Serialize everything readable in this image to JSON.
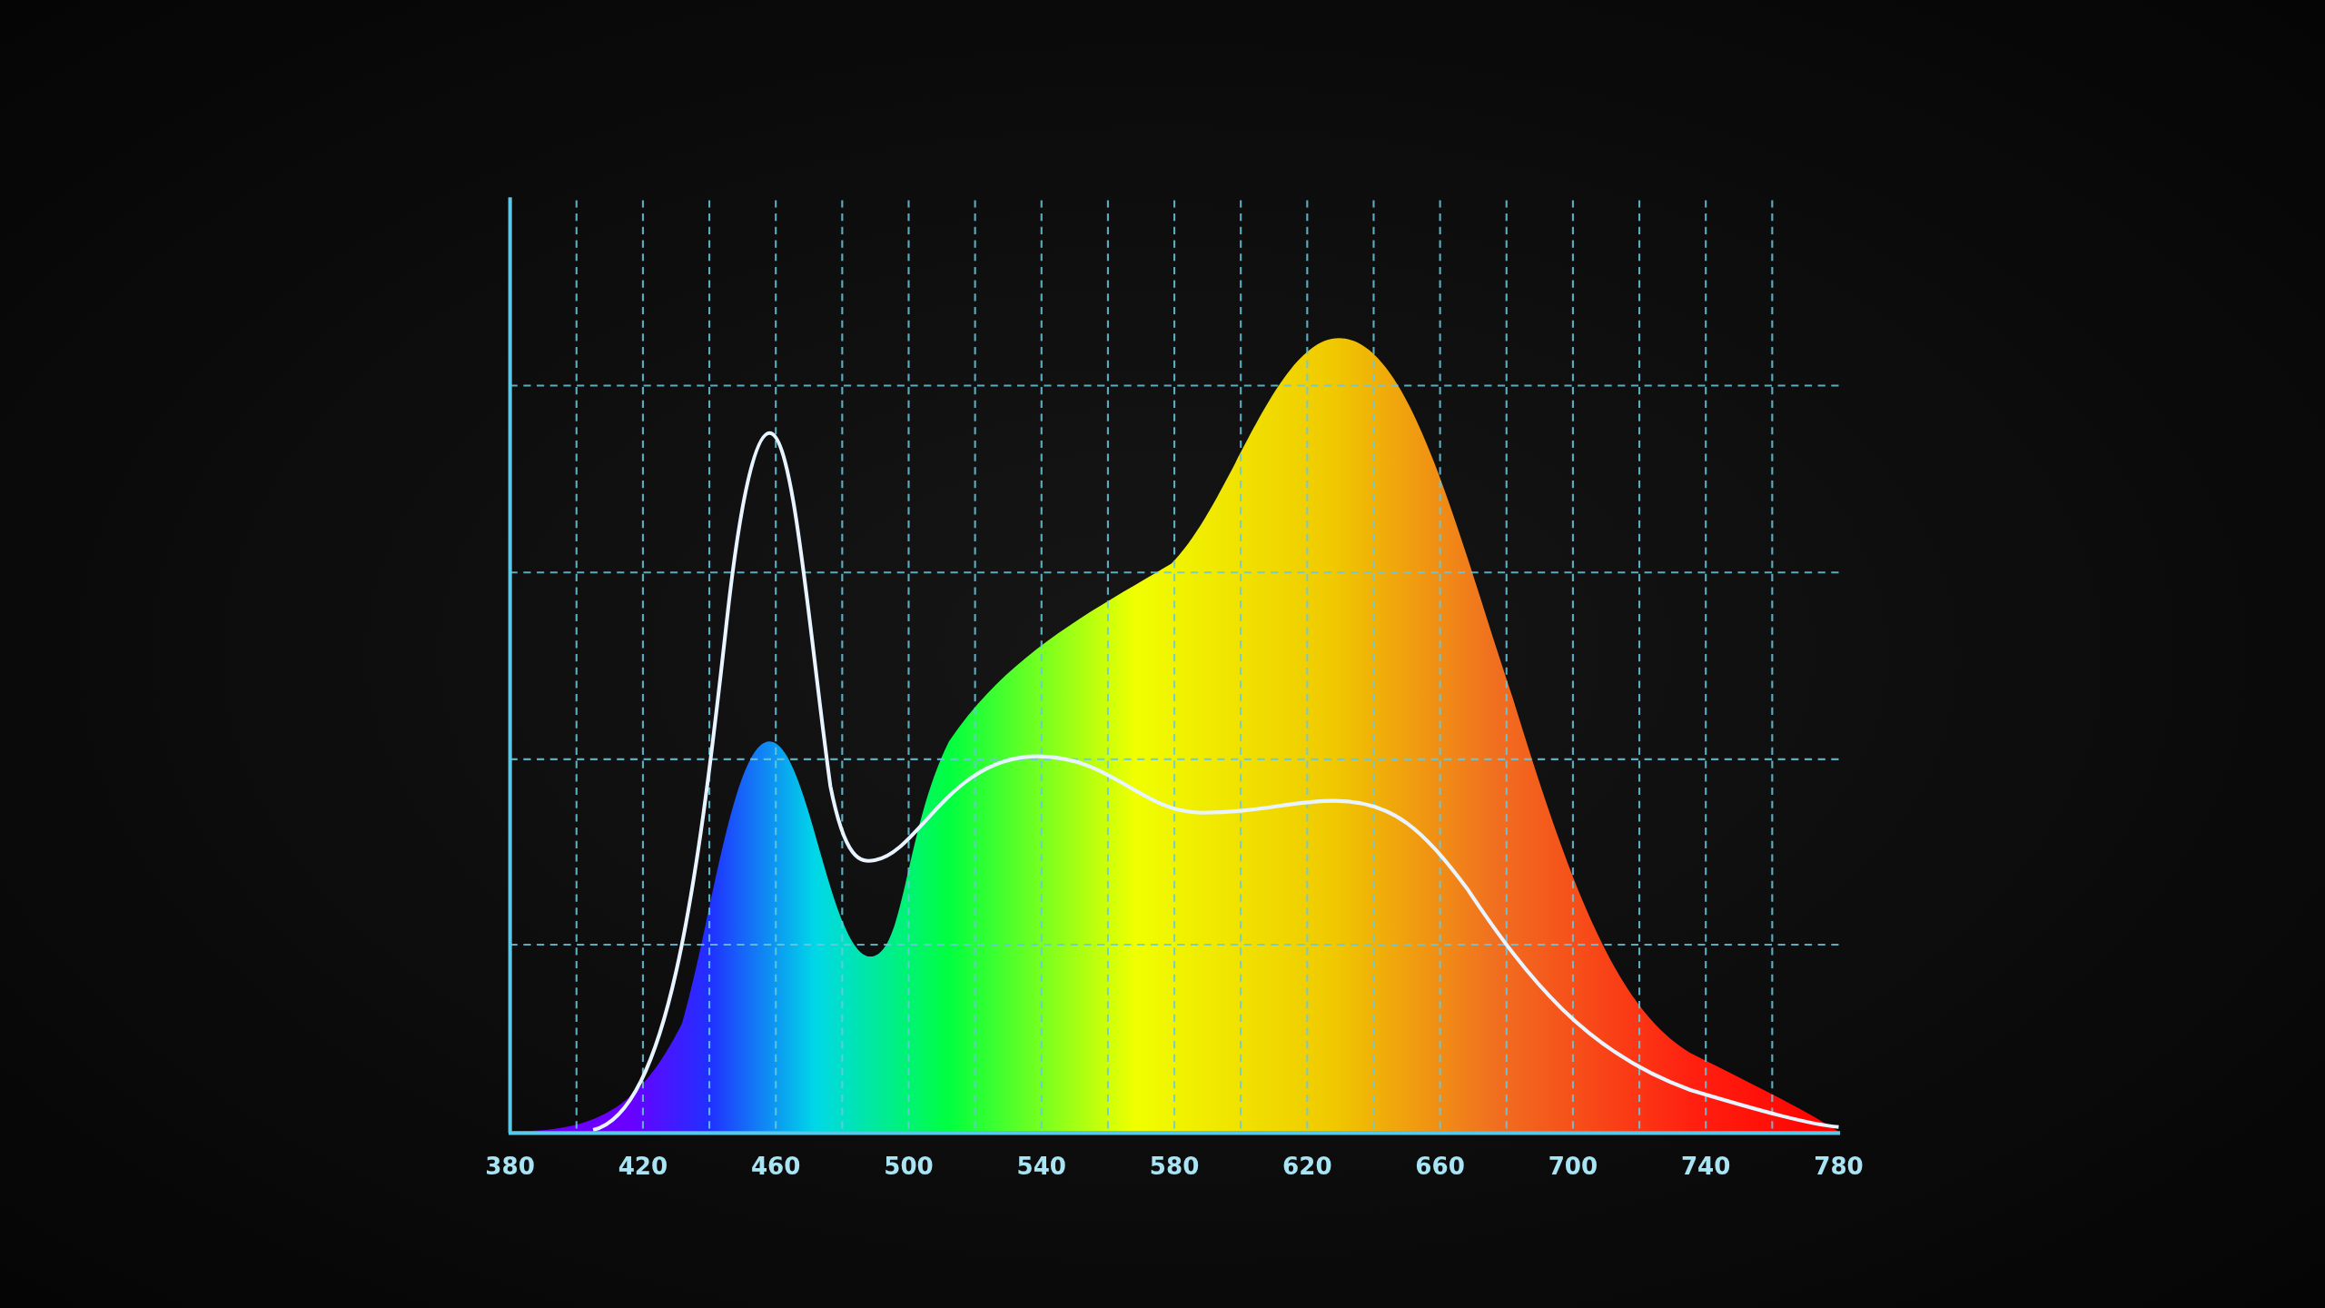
{
  "chart": {
    "x_axis_labels": [
      "380",
      "420",
      "460",
      "500",
      "540",
      "580",
      "620",
      "660",
      "700",
      "740",
      "780"
    ]
  }
}
